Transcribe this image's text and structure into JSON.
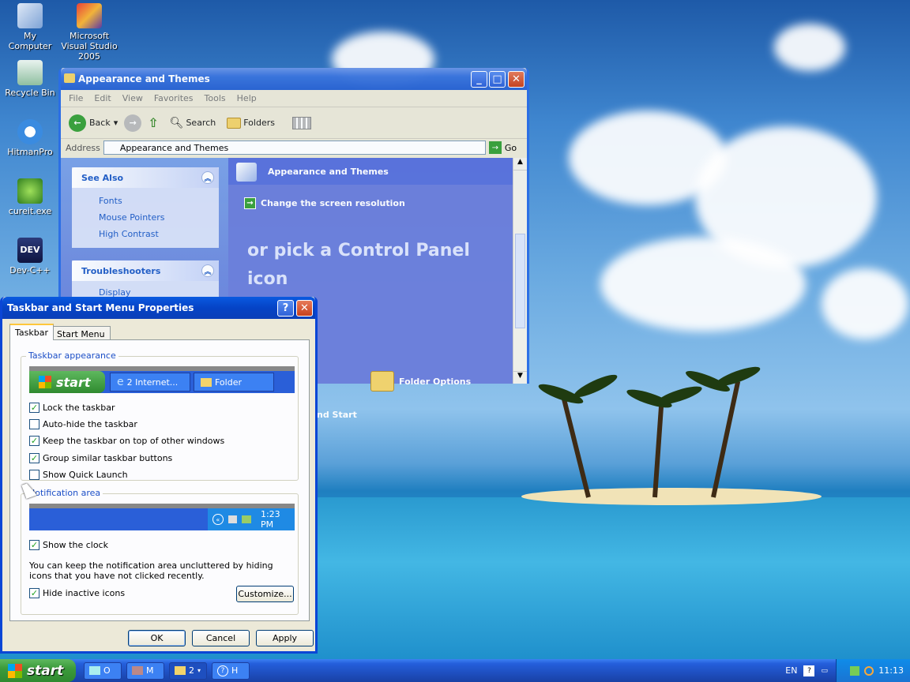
{
  "desktop": {
    "icons": [
      {
        "label": "My Computer",
        "icon": "computer-icon"
      },
      {
        "label": "Microsoft Visual Studio 2005",
        "icon": "visual-studio-icon"
      },
      {
        "label": "Recycle Bin",
        "icon": "recycle-bin-icon"
      },
      {
        "label": "HitmanPro",
        "icon": "hitmanpro-icon"
      },
      {
        "label": "cureit.exe",
        "icon": "cureit-icon"
      },
      {
        "label": "Dev-C++",
        "icon": "devcpp-icon"
      }
    ]
  },
  "explorer": {
    "title": "Appearance and Themes",
    "menu": [
      "File",
      "Edit",
      "View",
      "Favorites",
      "Tools",
      "Help"
    ],
    "toolbar": {
      "back": "Back",
      "search": "Search",
      "folders": "Folders"
    },
    "address_label": "Address",
    "address_value": "Appearance and Themes",
    "go": "Go",
    "see_also": {
      "title": "See Also",
      "items": [
        "Fonts",
        "Mouse Pointers",
        "High Contrast"
      ]
    },
    "troubleshooters": {
      "title": "Troubleshooters",
      "items": [
        "Display"
      ]
    },
    "content": {
      "header": "Appearance and Themes",
      "task": "Change the screen resolution",
      "pick_heading": "or pick a Control Panel icon",
      "folder_options": "Folder Options",
      "partial_item": "nd Start"
    }
  },
  "dialog": {
    "title": "Taskbar and Start Menu Properties",
    "tabs": [
      "Taskbar",
      "Start Menu"
    ],
    "taskbar_appearance": {
      "label": "Taskbar appearance",
      "preview": {
        "start": "start",
        "internet": "2 Internet...",
        "folder": "Folder"
      },
      "options": [
        {
          "label": "Lock the taskbar",
          "checked": true
        },
        {
          "label": "Auto-hide the taskbar",
          "checked": false
        },
        {
          "label": "Keep the taskbar on top of other windows",
          "checked": true
        },
        {
          "label": "Group similar taskbar buttons",
          "checked": true
        },
        {
          "label": "Show Quick Launch",
          "checked": false
        }
      ]
    },
    "notification_area": {
      "label": "Notification area",
      "preview_time": "1:23 PM",
      "show_clock": {
        "label": "Show the clock",
        "checked": true
      },
      "description": "You can keep the notification area uncluttered by hiding icons that you have not clicked recently.",
      "hide_inactive": {
        "label": "Hide inactive icons",
        "checked": true
      },
      "customize": "Customize..."
    },
    "buttons": {
      "ok": "OK",
      "cancel": "Cancel",
      "apply": "Apply"
    }
  },
  "taskbar": {
    "start": "start",
    "buttons": [
      {
        "label": "O",
        "icon": "outlook-icon"
      },
      {
        "label": "M",
        "icon": "media-icon"
      },
      {
        "label": "2",
        "icon": "folder-icon"
      },
      {
        "label": "H",
        "icon": "help-icon"
      }
    ],
    "language": "EN",
    "clock": "11:13"
  }
}
